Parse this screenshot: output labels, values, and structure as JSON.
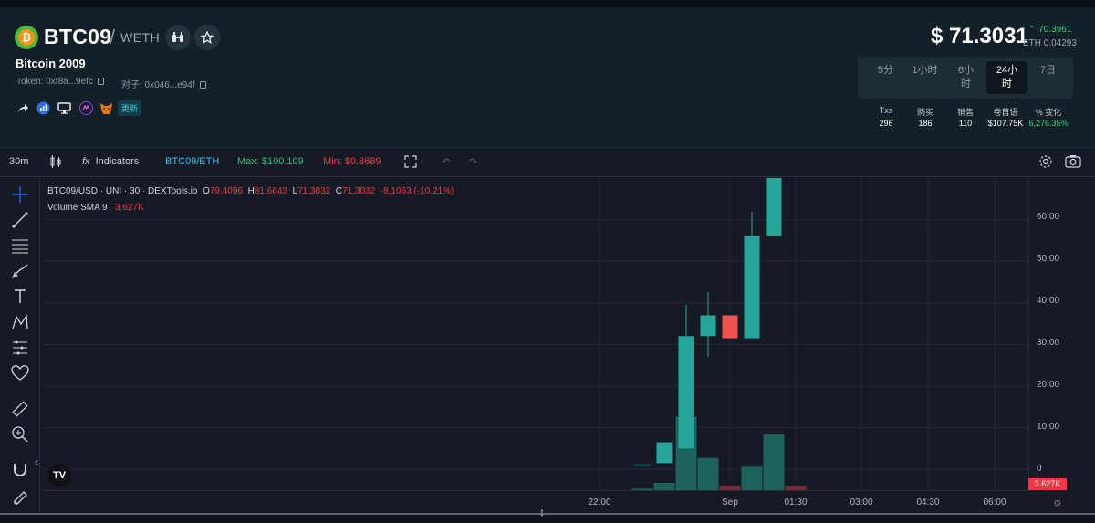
{
  "header": {
    "symbol": "BTC09",
    "separator": "/",
    "quote": "WETH",
    "name": "Bitcoin 2009",
    "token_label": "Token: 0xf8a...9efc",
    "pair_label": "对子: 0x046...e94f",
    "update_badge": "更新",
    "price": "$ 71.3031",
    "change": "70.3961",
    "eth_price": "ETH 0.04293",
    "accent_green": "#2fd07c"
  },
  "timeframes": [
    {
      "label": "5分",
      "active": false
    },
    {
      "label": "1小时",
      "active": false
    },
    {
      "label": "6小\n时",
      "active": false
    },
    {
      "label": "24小\n时",
      "active": true
    },
    {
      "label": "7日",
      "active": false
    }
  ],
  "stats": {
    "headers": [
      "Txs",
      "购买",
      "销售",
      "卷首语",
      "% 变化"
    ],
    "values": [
      "296",
      "186",
      "110",
      "$107.75K",
      "6,276.35%"
    ]
  },
  "toolbar": {
    "interval": "30m",
    "indicators": "Indicators",
    "pair": "BTC09/ETH",
    "max": "Max: $100.109",
    "min": "Min: $0.8689"
  },
  "chart_legend": {
    "title": "BTC09/USD · UNI · 30 · DEXTools.io",
    "o_label": "O",
    "o": "79.4096",
    "h_label": "H",
    "h": "81.6643",
    "l_label": "L",
    "l": "71.3032",
    "c_label": "C",
    "c": "71.3032",
    "chg": "-8.1063 (-10.21%)",
    "volume_label": "Volume SMA 9",
    "volume_value": "3.627K"
  },
  "chart_data": {
    "type": "candlestick",
    "y_ticks": [
      "60.00",
      "50.00",
      "40.00",
      "30.00",
      "20.00",
      "10.00",
      "0"
    ],
    "x_ticks": [
      "22:00",
      "Sep",
      "01:30",
      "03:00",
      "04:30",
      "06:00"
    ],
    "ylim": [
      -5,
      70
    ],
    "candles": [
      {
        "o": 1.0,
        "h": 1.2,
        "l": 0.9,
        "c": 1.2
      },
      {
        "o": 1.5,
        "h": 6.5,
        "l": 1.5,
        "c": 6.5
      },
      {
        "o": 5,
        "h": 39.5,
        "l": 5,
        "c": 32
      },
      {
        "o": 32,
        "h": 42.5,
        "l": 27,
        "c": 37
      },
      {
        "o": 37,
        "h": 37,
        "l": 31.5,
        "c": 31.5
      },
      {
        "o": 31.5,
        "h": 62,
        "l": 31.5,
        "c": 56
      },
      {
        "o": 56,
        "h": 71,
        "l": 56,
        "c": 71
      }
    ],
    "volumes": [
      0.05,
      0.25,
      2.5,
      1.1,
      0.15,
      0.8,
      1.9,
      0.15
    ],
    "volume_badge": "3.627K",
    "up_color": "#26a69a",
    "down_color": "#ef5350",
    "grid": true
  }
}
